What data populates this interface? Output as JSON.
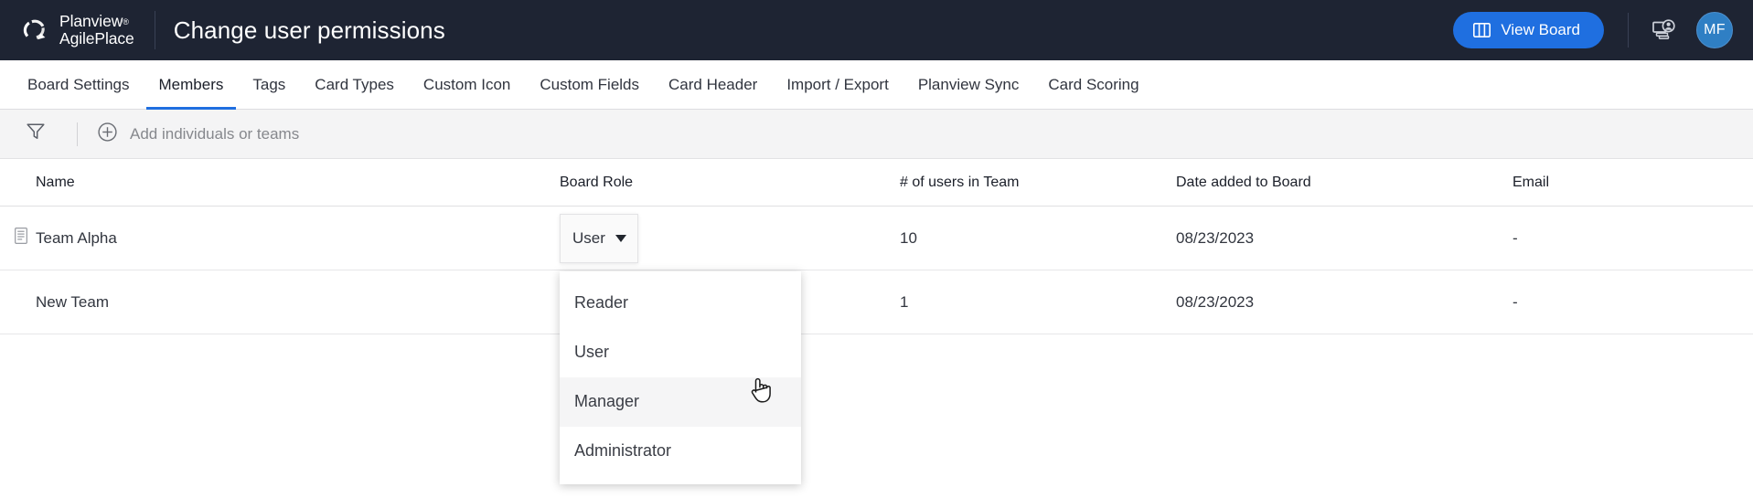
{
  "header": {
    "logo": {
      "mark": "planview-logo-icon",
      "line1": "Planview",
      "registered": "®",
      "line2": "AgilePlace"
    },
    "title": "Change user permissions",
    "view_board_label": "View Board",
    "view_board_icon": "board-columns-icon",
    "share_icon": "share-board-icon",
    "avatar_initials": "MF",
    "accent_blue": "#1f6fe0",
    "bar_background": "#1e2433",
    "avatar_background": "#2f7fc4"
  },
  "tabs": {
    "active_index": 1,
    "items": [
      {
        "label": "Board Settings"
      },
      {
        "label": "Members"
      },
      {
        "label": "Tags"
      },
      {
        "label": "Card Types"
      },
      {
        "label": "Custom Icon"
      },
      {
        "label": "Custom Fields"
      },
      {
        "label": "Card Header"
      },
      {
        "label": "Import / Export"
      },
      {
        "label": "Planview Sync"
      },
      {
        "label": "Card Scoring"
      }
    ]
  },
  "toolbar": {
    "filter_icon": "filter-funnel-icon",
    "add_icon": "plus-circle-icon",
    "add_placeholder": "Add individuals or teams"
  },
  "table": {
    "columns": [
      {
        "key": "name",
        "label": "Name"
      },
      {
        "key": "role",
        "label": "Board Role"
      },
      {
        "key": "users",
        "label": "# of users in Team"
      },
      {
        "key": "date",
        "label": "Date added to Board"
      },
      {
        "key": "email",
        "label": "Email"
      }
    ],
    "rows": [
      {
        "name": "Team Alpha",
        "has_team_icon": true,
        "role": "User",
        "users": "10",
        "date": "08/23/2023",
        "email": "-"
      },
      {
        "name": "New Team",
        "has_team_icon": false,
        "role": "",
        "users": "1",
        "date": "08/23/2023",
        "email": "-"
      }
    ]
  },
  "role_dropdown": {
    "open": true,
    "selected": "User",
    "hovered": "Manager",
    "options": [
      {
        "label": "Reader"
      },
      {
        "label": "User"
      },
      {
        "label": "Manager"
      },
      {
        "label": "Administrator"
      }
    ]
  },
  "cursor": {
    "icon": "pointing-hand-cursor"
  }
}
